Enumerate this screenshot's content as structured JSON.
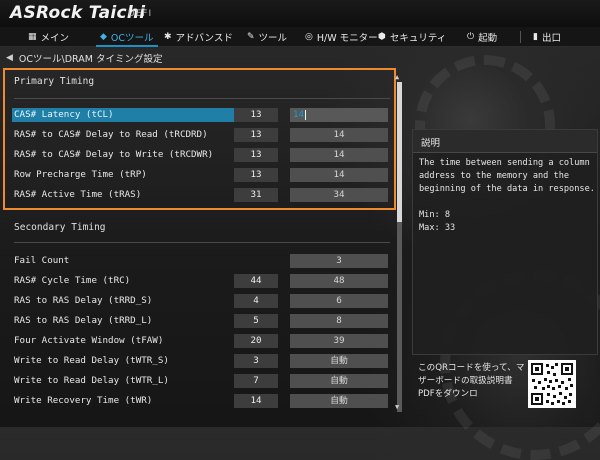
{
  "header": {
    "brand": "ASRock Taichi",
    "uefi": "UEFI"
  },
  "nav": [
    {
      "icon": "▦",
      "label": "メイン"
    },
    {
      "icon": "◆",
      "label": "OCツール"
    },
    {
      "icon": "✱",
      "label": "アドバンスド"
    },
    {
      "icon": "✎",
      "label": "ツール"
    },
    {
      "icon": "◎",
      "label": "H/W モニター"
    },
    {
      "icon": "⬢",
      "label": "セキュリティ"
    },
    {
      "icon": "⏻",
      "label": "起動"
    },
    {
      "icon": "▮",
      "label": "出口"
    }
  ],
  "breadcrumb": "OCツール\\DRAM タイミング設定",
  "primary": {
    "title": "Primary Timing",
    "rows": [
      {
        "label": "CAS# Latency (tCL)",
        "current": "13",
        "setting": "14"
      },
      {
        "label": "RAS# to CAS# Delay to Read  (tRCDRD)",
        "current": "13",
        "setting": "14"
      },
      {
        "label": "RAS# to CAS# Delay to Write (tRCDWR)",
        "current": "13",
        "setting": "14"
      },
      {
        "label": "Row Precharge Time (tRP)",
        "current": "13",
        "setting": "14"
      },
      {
        "label": "RAS# Active Time (tRAS)",
        "current": "31",
        "setting": "34"
      }
    ]
  },
  "secondary": {
    "title": "Secondary Timing",
    "rows": [
      {
        "label": "Fail Count",
        "current": "",
        "setting": "3"
      },
      {
        "label": "RAS# Cycle Time (tRC)",
        "current": "44",
        "setting": "48"
      },
      {
        "label": "RAS to RAS Delay (tRRD_S)",
        "current": "4",
        "setting": "6"
      },
      {
        "label": "RAS to RAS Delay (tRRD_L)",
        "current": "5",
        "setting": "8"
      },
      {
        "label": "Four Activate Window (tFAW)",
        "current": "20",
        "setting": "39"
      },
      {
        "label": "Write to Read Delay (tWTR_S)",
        "current": "3",
        "setting": "自動"
      },
      {
        "label": "Write to Read Delay (tWTR_L)",
        "current": "7",
        "setting": "自動"
      },
      {
        "label": "Write Recovery Time (tWR)",
        "current": "14",
        "setting": "自動"
      }
    ]
  },
  "description": {
    "title": "説明",
    "text": "The time between sending a column address to the memory and the beginning of the data in response.",
    "min": "Min: 8",
    "max": "Max: 33"
  },
  "qr": {
    "text": "このQRコードを使って、マザーボードの取扱説明書PDFをダウンロ"
  },
  "colors": {
    "accent": "#1f7fa6",
    "active_tab": "#3fb3e6",
    "highlight_box": "#f08a30"
  }
}
